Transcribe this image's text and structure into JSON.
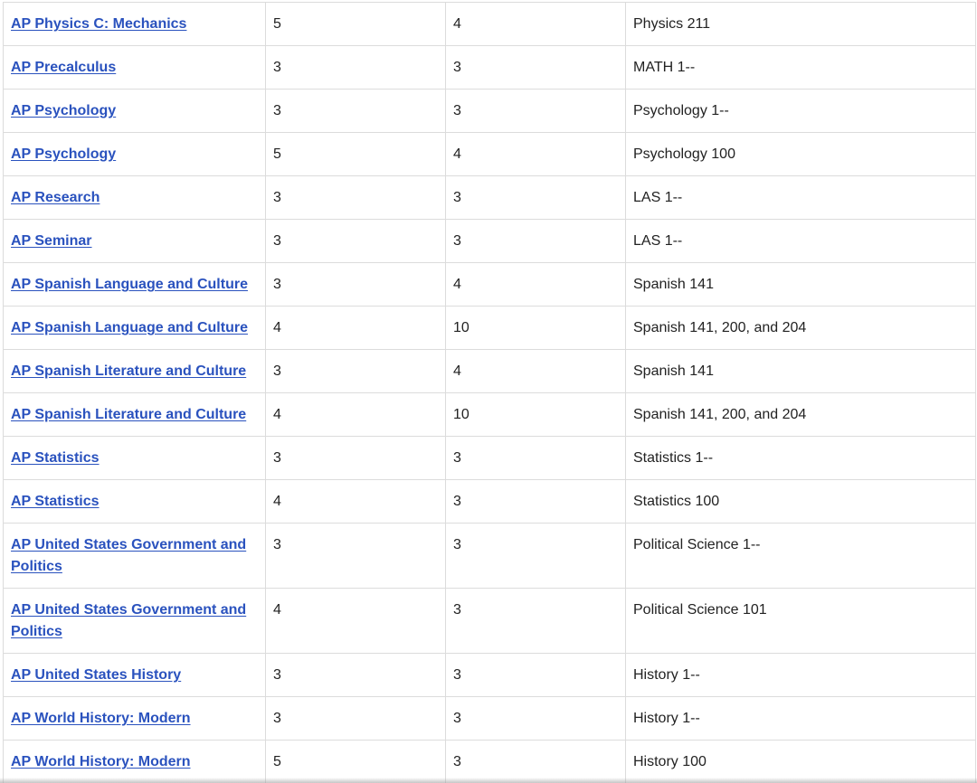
{
  "table": {
    "rows": [
      {
        "exam": "AP Physics C: Mechanics",
        "score": "5",
        "credits": "4",
        "course": "Physics 211"
      },
      {
        "exam": "AP Precalculus",
        "score": "3",
        "credits": "3",
        "course": "MATH 1--"
      },
      {
        "exam": "AP Psychology",
        "score": "3",
        "credits": "3",
        "course": "Psychology 1--"
      },
      {
        "exam": "AP Psychology",
        "score": "5",
        "credits": "4",
        "course": "Psychology 100"
      },
      {
        "exam": "AP Research",
        "score": "3",
        "credits": "3",
        "course": "LAS 1--"
      },
      {
        "exam": "AP Seminar",
        "score": "3",
        "credits": "3",
        "course": "LAS 1--"
      },
      {
        "exam": "AP Spanish Language and Culture",
        "score": "3",
        "credits": "4",
        "course": "Spanish 141"
      },
      {
        "exam": "AP Spanish Language and Culture",
        "score": "4",
        "credits": "10",
        "course": "Spanish 141, 200, and 204"
      },
      {
        "exam": "AP Spanish Literature and Culture",
        "score": "3",
        "credits": "4",
        "course": "Spanish 141"
      },
      {
        "exam": "AP Spanish Literature and Culture",
        "score": "4",
        "credits": "10",
        "course": "Spanish 141, 200, and 204"
      },
      {
        "exam": "AP Statistics",
        "score": "3",
        "credits": "3",
        "course": "Statistics 1--"
      },
      {
        "exam": "AP Statistics",
        "score": "4",
        "credits": "3",
        "course": "Statistics 100"
      },
      {
        "exam": "AP United States Government and Politics",
        "score": "3",
        "credits": "3",
        "course": "Political Science 1--"
      },
      {
        "exam": "AP United States Government and Politics",
        "score": "4",
        "credits": "3",
        "course": "Political Science 101"
      },
      {
        "exam": "AP United States History",
        "score": "3",
        "credits": "3",
        "course": "History 1--"
      },
      {
        "exam": "AP World History: Modern",
        "score": "3",
        "credits": "3",
        "course": "History 1--"
      },
      {
        "exam": "AP World History: Modern",
        "score": "5",
        "credits": "3",
        "course": "History 100"
      }
    ]
  },
  "colors": {
    "link": "#2a52be",
    "text": "#222222",
    "border": "#dcdcdc"
  }
}
